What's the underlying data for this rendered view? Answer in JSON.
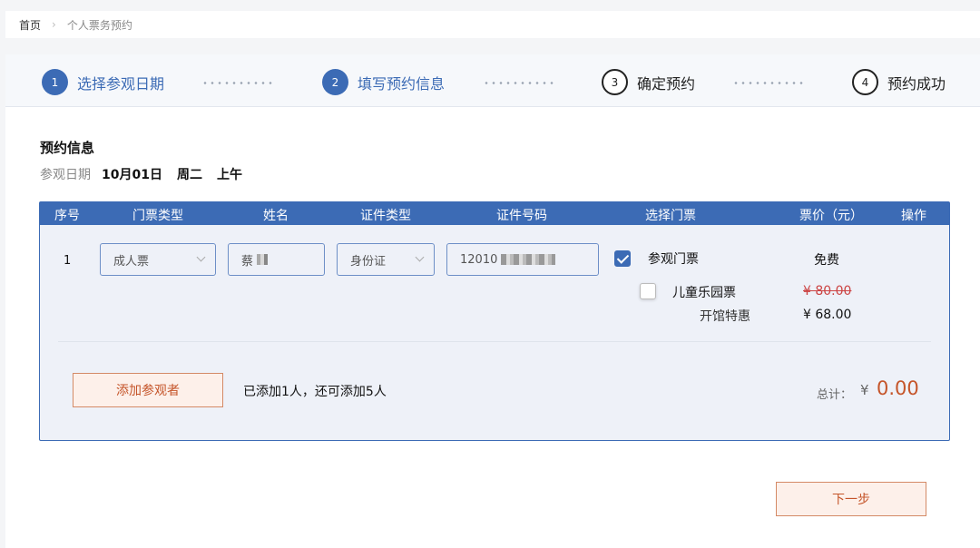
{
  "breadcrumb": {
    "home": "首页",
    "separator": "›",
    "current": "个人票务预约"
  },
  "steps": [
    {
      "num": "1",
      "label": "选择参观日期",
      "state": "done"
    },
    {
      "num": "2",
      "label": "填写预约信息",
      "state": "done"
    },
    {
      "num": "3",
      "label": "确定预约",
      "state": "todo"
    },
    {
      "num": "4",
      "label": "预约成功",
      "state": "todo"
    }
  ],
  "section": {
    "title": "预约信息",
    "date_label": "参观日期",
    "date": "10月01日",
    "weekday": "周二",
    "period": "上午"
  },
  "table": {
    "headers": [
      "序号",
      "门票类型",
      "姓名",
      "证件类型",
      "证件号码",
      "选择门票",
      "票价（元）",
      "操作"
    ],
    "row": {
      "index": "1",
      "ticket_type": "成人票",
      "name": "蔡",
      "id_type": "身份证",
      "id_number": "12010",
      "tickets": [
        {
          "name": "参观门票",
          "checked": true,
          "price": "免费"
        },
        {
          "name": "儿童乐园票",
          "checked": false,
          "orig_price": "¥ 80.00",
          "promo_label": "开馆特惠",
          "promo_price": "¥ 68.00"
        }
      ]
    }
  },
  "footer": {
    "add_button": "添加参观者",
    "add_info": "已添加1人，还可添加5人",
    "total_label": "总计：",
    "currency": "¥",
    "total_value": "0.00"
  },
  "next_button": "下一步",
  "colors": {
    "primary": "#3c6bb5",
    "accent": "#c5552a"
  }
}
